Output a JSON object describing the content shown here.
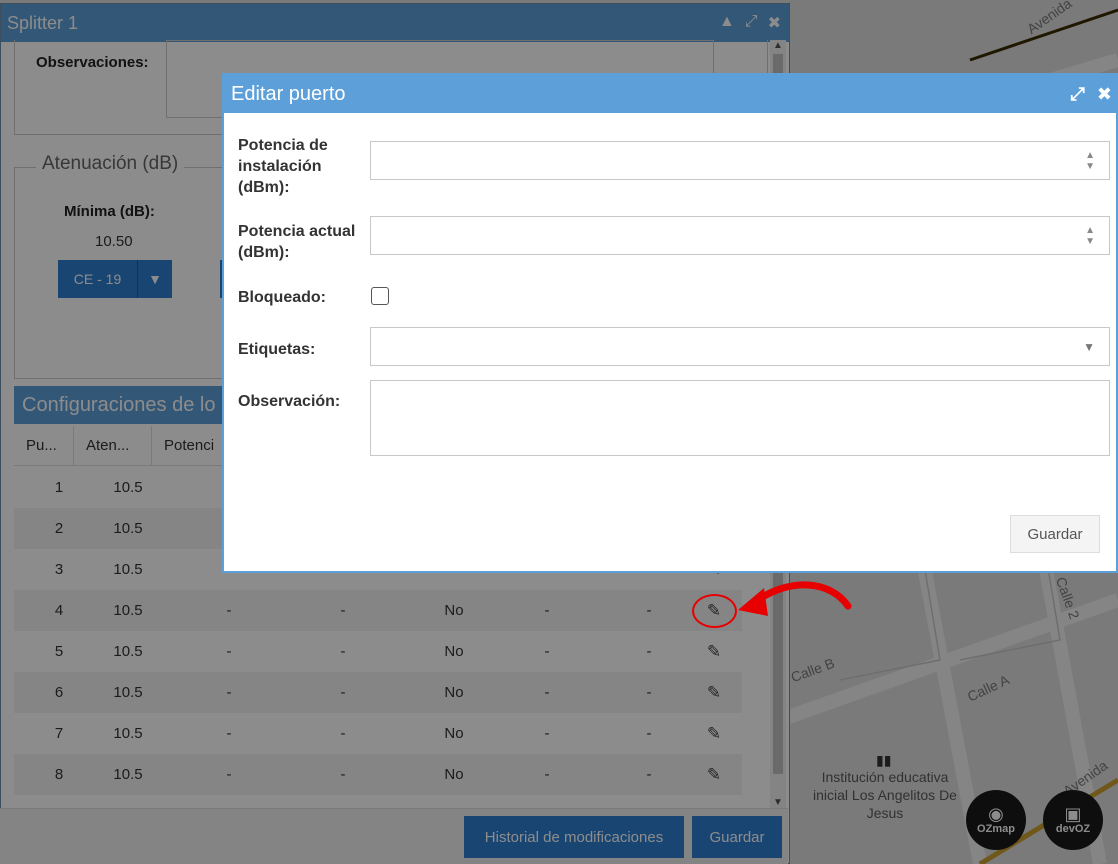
{
  "map": {
    "street_labels": [
      "Avenida",
      "Calle B",
      "Calle A",
      "Calle 2",
      "Avenida"
    ],
    "poi": "Institución educativa inicial Los Angelitos De Jesus",
    "badges": [
      {
        "text": "OZmap",
        "icon": "map-pin-icon"
      },
      {
        "text": "devOZ",
        "icon": "box-icon"
      }
    ]
  },
  "splitter": {
    "title": "Splitter 1",
    "observaciones_label": "Observaciones:",
    "atenuacion_legend": "Atenuación (dB)",
    "minima_label": "Mínima (dB):",
    "minima_value": "10.50",
    "ce_button": "CE - 19",
    "configuraciones_title": "Configuraciones de lo",
    "columns": [
      "Pu...",
      "Aten...",
      "Potenci"
    ],
    "rows": [
      {
        "puerto": "1",
        "aten": "10.5",
        "c3": "-",
        "c4": "",
        "bloq": "",
        "c6": "",
        "c7": ""
      },
      {
        "puerto": "2",
        "aten": "10.5",
        "c3": "-",
        "c4": "",
        "bloq": "",
        "c6": "",
        "c7": ""
      },
      {
        "puerto": "3",
        "aten": "10.5",
        "c3": "-",
        "c4": "",
        "bloq": "",
        "c6": "",
        "c7": ""
      },
      {
        "puerto": "4",
        "aten": "10.5",
        "c3": "-",
        "c4": "-",
        "bloq": "No",
        "c6": "-",
        "c7": "-"
      },
      {
        "puerto": "5",
        "aten": "10.5",
        "c3": "-",
        "c4": "-",
        "bloq": "No",
        "c6": "-",
        "c7": "-"
      },
      {
        "puerto": "6",
        "aten": "10.5",
        "c3": "-",
        "c4": "-",
        "bloq": "No",
        "c6": "-",
        "c7": "-"
      },
      {
        "puerto": "7",
        "aten": "10.5",
        "c3": "-",
        "c4": "-",
        "bloq": "No",
        "c6": "-",
        "c7": "-"
      },
      {
        "puerto": "8",
        "aten": "10.5",
        "c3": "-",
        "c4": "-",
        "bloq": "No",
        "c6": "-",
        "c7": "-"
      }
    ],
    "historial_button": "Historial de modificaciones",
    "guardar_button": "Guardar"
  },
  "modal": {
    "title": "Editar puerto",
    "fields": {
      "potencia_instalacion_label": "Potencia de instalación (dBm):",
      "potencia_actual_label": "Potencia actual (dBm):",
      "bloqueado_label": "Bloqueado:",
      "etiquetas_label": "Etiquetas:",
      "observacion_label": "Observación:"
    },
    "values": {
      "potencia_instalacion": "",
      "potencia_actual": "",
      "etiquetas": "",
      "observacion": ""
    },
    "bloqueado_checked": false,
    "save_button": "Guardar"
  },
  "colors": {
    "title_bar": "#5c9fd9",
    "primary_button": "#2f7fd0",
    "annotation": "#e60000"
  }
}
